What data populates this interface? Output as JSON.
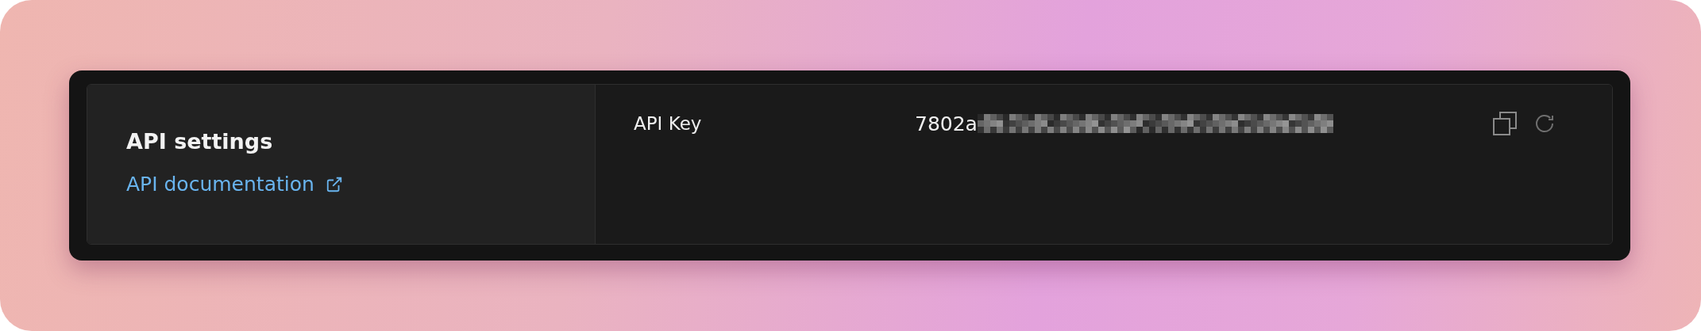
{
  "panel": {
    "title": "API settings",
    "link": "API documentation"
  },
  "fields": [
    {
      "label": "API Key",
      "value": "7802a",
      "redacted": true
    }
  ]
}
